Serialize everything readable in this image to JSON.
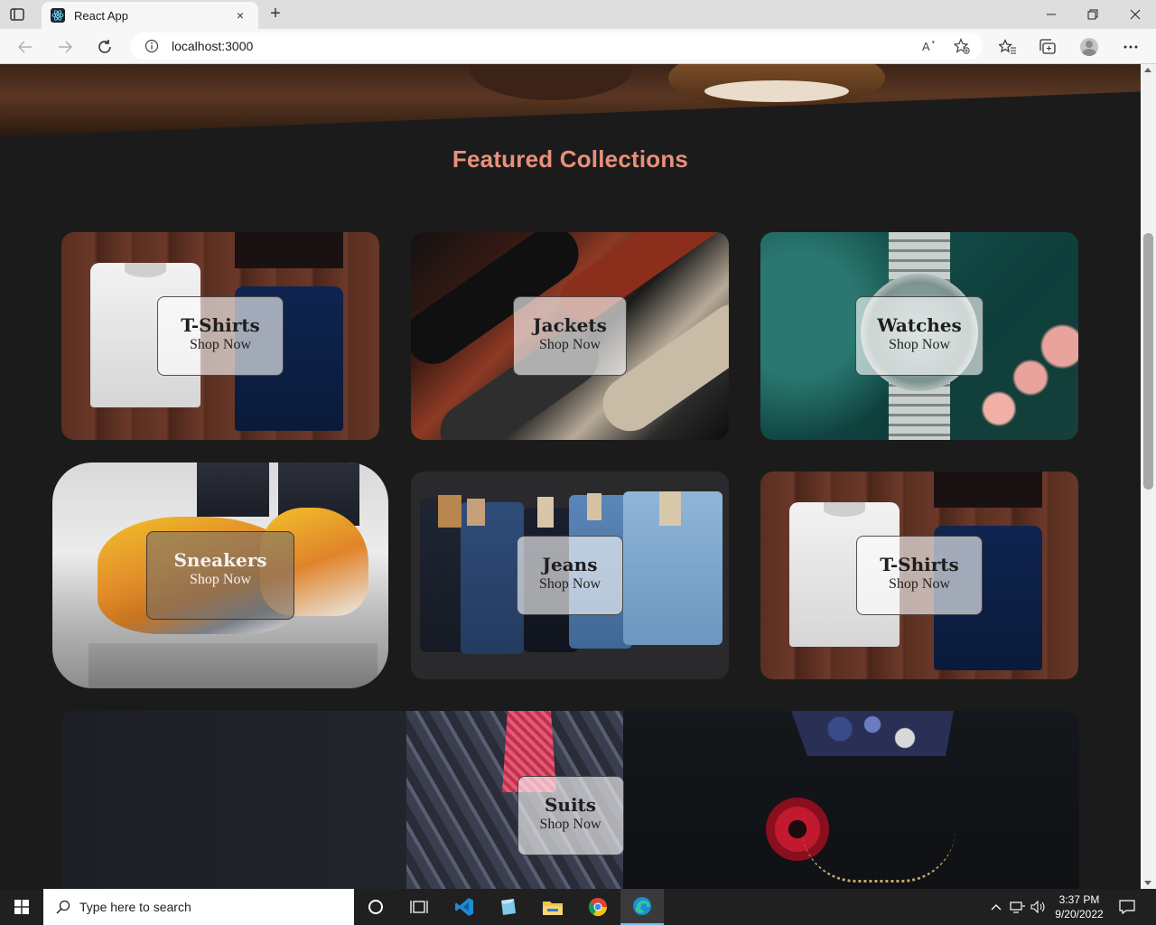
{
  "browser": {
    "tab_title": "React App",
    "url": "localhost:3000",
    "new_tab_symbol": "+",
    "close_tab_symbol": "×"
  },
  "page": {
    "section_title": "Featured Collections",
    "accent_color": "#e8907b",
    "collections": [
      {
        "name": "T-Shirts",
        "cta": "Shop Now"
      },
      {
        "name": "Jackets",
        "cta": "Shop Now"
      },
      {
        "name": "Watches",
        "cta": "Shop Now"
      },
      {
        "name": "Sneakers",
        "cta": "Shop Now"
      },
      {
        "name": "Jeans",
        "cta": "Shop Now"
      },
      {
        "name": "T-Shirts",
        "cta": "Shop Now"
      },
      {
        "name": "Suits",
        "cta": "Shop Now"
      }
    ]
  },
  "taskbar": {
    "search_placeholder": "Type here to search",
    "time": "3:37 PM",
    "date": "9/20/2022",
    "pinned_apps": [
      "task-view-icon",
      "vscode-icon",
      "notepad-icon",
      "file-explorer-icon",
      "chrome-icon",
      "edge-icon"
    ]
  },
  "icons": {
    "tab_actions": "tab-actions-icon",
    "minimize": "minimize-icon",
    "restore": "restore-icon",
    "close": "close-icon",
    "back": "back-icon",
    "forward": "forward-icon",
    "refresh": "refresh-icon",
    "info": "info-icon",
    "read_aloud": "read-aloud-icon",
    "add_favorite": "add-favorite-icon",
    "favorites": "favorites-icon",
    "collections": "collections-icon",
    "profile": "profile-icon",
    "menu": "more-menu-icon"
  }
}
